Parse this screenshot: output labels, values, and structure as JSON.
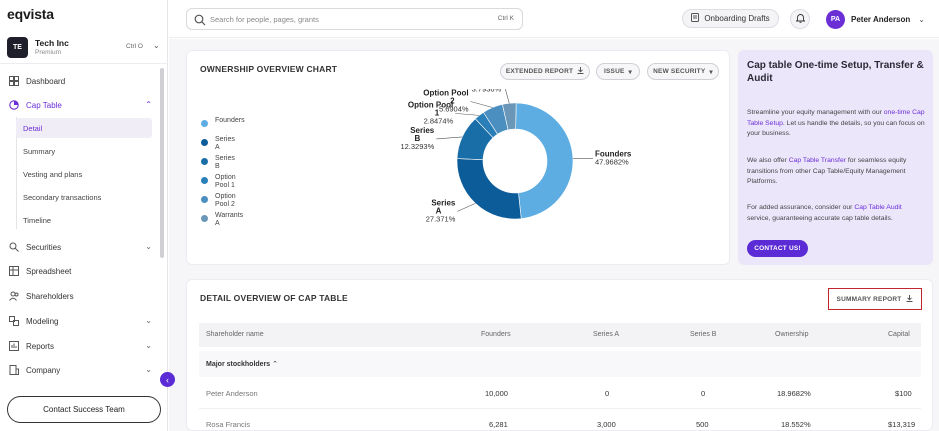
{
  "app": {
    "logo": "eqvista",
    "company": {
      "initials": "TE",
      "name": "Tech Inc",
      "plan": "Premium",
      "shortcut": "Ctrl O"
    }
  },
  "sidebar": {
    "items": [
      {
        "label": "Dashboard",
        "icon": "dashboard-icon"
      },
      {
        "label": "Cap Table",
        "icon": "cap-table-icon"
      },
      {
        "label": "Securities",
        "icon": "securities-icon"
      },
      {
        "label": "Spreadsheet",
        "icon": "spreadsheet-icon"
      },
      {
        "label": "Shareholders",
        "icon": "shareholders-icon"
      },
      {
        "label": "Modeling",
        "icon": "modeling-icon"
      },
      {
        "label": "Reports",
        "icon": "reports-icon"
      },
      {
        "label": "Company",
        "icon": "company-icon"
      }
    ],
    "cap_table_sub": [
      "Detail",
      "Summary",
      "Vesting and plans",
      "Secondary transactions",
      "Timeline"
    ],
    "contact_button": "Contact Success Team"
  },
  "topbar": {
    "search_placeholder": "Search for people, pages, grants",
    "search_shortcut": "Ctrl K",
    "drafts_label": "Onboarding Drafts",
    "user_initials": "PA",
    "user_name": "Peter Anderson"
  },
  "ownership_chart": {
    "title": "OWNERSHIP OVERVIEW CHART",
    "buttons": {
      "extended_report": "EXTENDED REPORT",
      "issue": "ISSUE",
      "new_security": "NEW SECURITY"
    }
  },
  "chart_data": {
    "type": "pie",
    "title": "OWNERSHIP OVERVIEW CHART",
    "donut": true,
    "legend_position": "left",
    "slices": [
      {
        "name": "Founders",
        "value": 47.9682,
        "label": "47.9682%",
        "color": "#5dade2"
      },
      {
        "name": "Series A",
        "value": 27.371,
        "label": "27.371%",
        "color": "#0d5c9a"
      },
      {
        "name": "Series B",
        "value": 12.3293,
        "label": "12.3293%",
        "color": "#1a6ea8"
      },
      {
        "name": "Option Pool 1",
        "value": 2.8474,
        "label": "2.8474%",
        "color": "#2a7fb8"
      },
      {
        "name": "Option Pool 2",
        "value": 5.6904,
        "label": "5.6904%",
        "color": "#4a8fc0"
      },
      {
        "name": "Warrants A",
        "value": 3.7936,
        "label": "3.7936%",
        "color": "#6a97b8"
      }
    ],
    "legend": [
      {
        "line1": "Founders",
        "line2": "",
        "color": "#5dade2"
      },
      {
        "line1": "Series",
        "line2": "A",
        "color": "#0d5c9a"
      },
      {
        "line1": "Series",
        "line2": "B",
        "color": "#1a6ea8"
      },
      {
        "line1": "Option",
        "line2": "Pool 1",
        "color": "#2a7fb8"
      },
      {
        "line1": "Option",
        "line2": "Pool 2",
        "color": "#4a8fc0"
      },
      {
        "line1": "Warrants",
        "line2": "A",
        "color": "#6a97b8"
      }
    ]
  },
  "promo": {
    "title": "Cap table One-time Setup, Transfer & Audit",
    "p1_a": "Streamline your equity management with our ",
    "p1_link": "one-time Cap Table Setup",
    "p1_b": ". Let us handle the details, so you can focus on your business.",
    "p2_a": "We also offer ",
    "p2_link": "Cap Table Transfer",
    "p2_b": " for seamless equity transitions from other Cap Table/Equity Management Platforms.",
    "p3_a": "For added assurance, consider our ",
    "p3_link": "Cap Table Audit",
    "p3_b": " service, guaranteeing accurate cap table details.",
    "cta": "CONTACT US!"
  },
  "detail_table": {
    "title": "DETAIL OVERVIEW OF CAP TABLE",
    "summary_button": "SUMMARY REPORT",
    "columns": [
      "Shareholder name",
      "Founders",
      "Series A",
      "Series B",
      "Ownership",
      "Capital"
    ],
    "group_label": "Major stockholders",
    "rows": [
      {
        "name": "Peter Anderson",
        "founders": "10,000",
        "series_a": "0",
        "series_b": "0",
        "ownership": "18.9682%",
        "capital": "$100"
      },
      {
        "name": "Rosa Francis",
        "founders": "6,281",
        "series_a": "3,000",
        "series_b": "500",
        "ownership": "18.552%",
        "capital": "$13,319"
      }
    ]
  },
  "colors": {
    "accent": "#6b2fd6",
    "cta": "#5b2bd6",
    "promo_bg": "#ece6fb",
    "highlight_border": "#c0262d"
  }
}
